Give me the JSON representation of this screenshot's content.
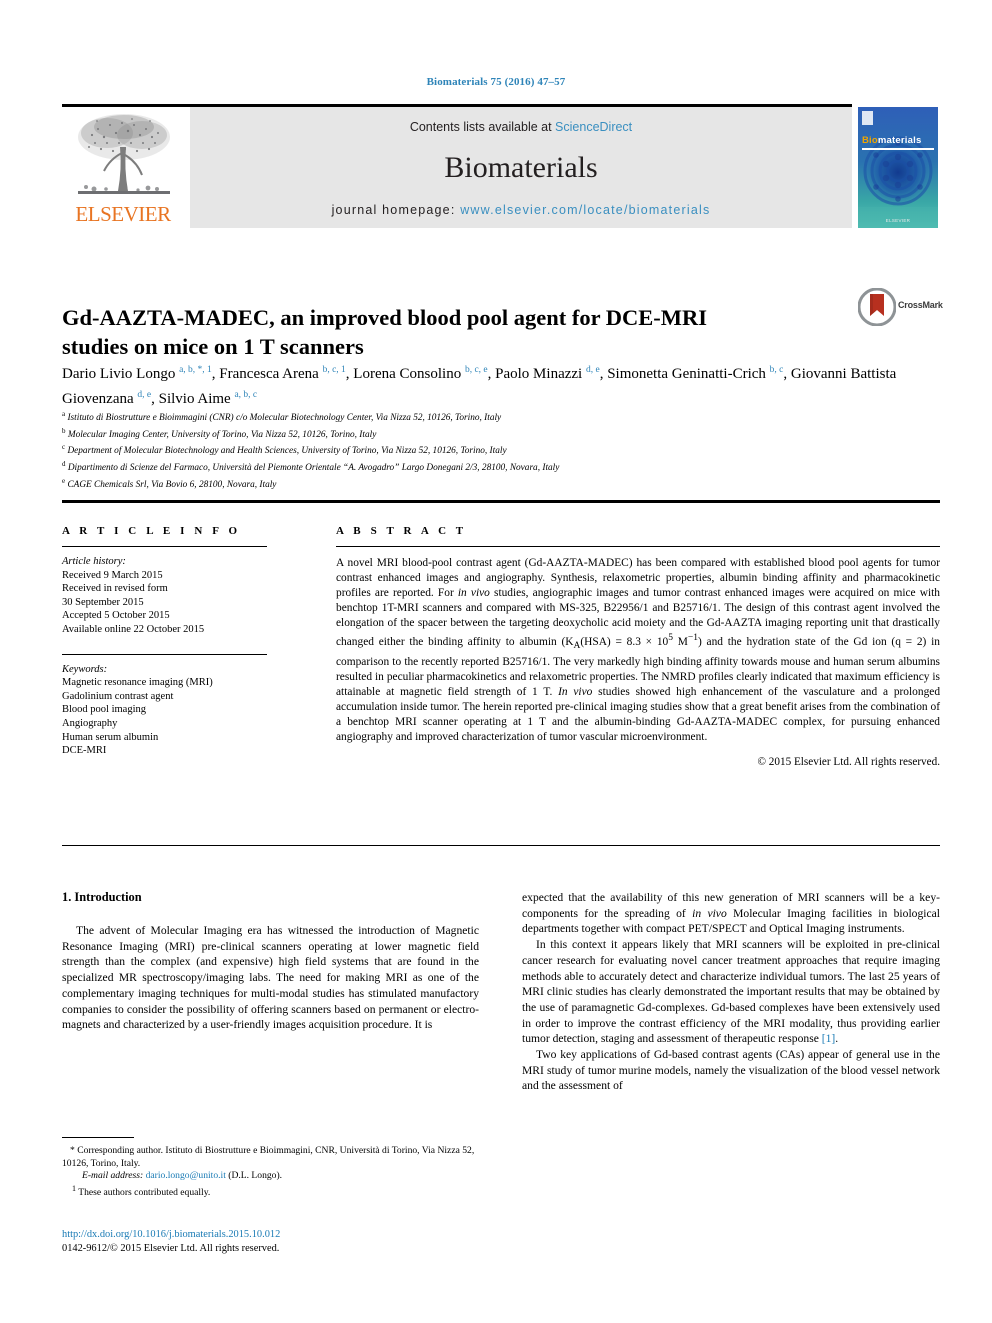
{
  "running_head": "Biomaterials 75 (2016) 47–57",
  "masthead": {
    "contents_prefix": "Contents lists available at ",
    "sciencedirect": "ScienceDirect",
    "journal_name": "Biomaterials",
    "homepage_prefix": "journal homepage: ",
    "homepage_url": "www.elsevier.com/locate/biomaterials",
    "publisher": "ELSEVIER",
    "link_color": "#3a8fc0",
    "box_color": "#e6e6e6"
  },
  "cover": {
    "title_prefix": "Bio",
    "title_rest": "materials",
    "footer": "ELSEVIER"
  },
  "article": {
    "title": "Gd-AAZTA-MADEC, an improved blood pool agent for DCE-MRI studies on mice on 1 T scanners",
    "crossmark_label": "CrossMark",
    "authors": [
      {
        "name": "Dario Livio Longo",
        "sup": "a, b, *, 1",
        "sep": ", "
      },
      {
        "name": "Francesca Arena",
        "sup": "b, c, 1",
        "sep": ", "
      },
      {
        "name": "Lorena Consolino",
        "sup": "b, c, e",
        "sep": ", "
      },
      {
        "name": "Paolo Minazzi",
        "sup": "d, e",
        "sep": ", "
      },
      {
        "name": "Simonetta Geninatti-Crich",
        "sup": "b, c",
        "sep": ", "
      },
      {
        "name": "Giovanni Battista Giovenzana",
        "sup": "d, e",
        "sep": ", "
      },
      {
        "name": "Silvio Aime",
        "sup": "a, b, c",
        "sep": ""
      }
    ],
    "affiliations": [
      {
        "mark": "a",
        "text": "Istituto di Biostrutture e Bioimmagini (CNR) c/o Molecular Biotechnology Center, Via Nizza 52, 10126, Torino, Italy"
      },
      {
        "mark": "b",
        "text": "Molecular Imaging Center, University of Torino, Via Nizza 52, 10126, Torino, Italy"
      },
      {
        "mark": "c",
        "text": "Department of Molecular Biotechnology and Health Sciences, University of Torino, Via Nizza 52, 10126, Torino, Italy"
      },
      {
        "mark": "d",
        "text": "Dipartimento di Scienze del Farmaco, Università del Piemonte Orientale “A. Avogadro” Largo Donegani 2/3, 28100, Novara, Italy"
      },
      {
        "mark": "e",
        "text": "CAGE Chemicals Srl, Via Bovio 6, 28100, Novara, Italy"
      }
    ]
  },
  "article_info": {
    "heading": "A R T I C L E   I N F O",
    "history_label": "Article history:",
    "history": [
      "Received 9 March 2015",
      "Received in revised form",
      "30 September 2015",
      "Accepted 5 October 2015",
      "Available online 22 October 2015"
    ],
    "keywords_label": "Keywords:",
    "keywords": [
      "Magnetic resonance imaging (MRI)",
      "Gadolinium contrast agent",
      "Blood pool imaging",
      "Angiography",
      "Human serum albumin",
      "DCE-MRI"
    ]
  },
  "abstract": {
    "heading": "A B S T R A C T",
    "text_part1": "A novel MRI blood-pool contrast agent (Gd-AAZTA-MADEC) has been compared with established blood pool agents for tumor contrast enhanced images and angiography. Synthesis, relaxometric properties, albumin binding affinity and pharmacokinetic profiles are reported. For ",
    "italic1": "in vivo",
    "text_part2": " studies, angiographic images and tumor contrast enhanced images were acquired on mice with benchtop 1T-MRI scanners and compared with MS-325, B22956/1 and B25716/1. The design of this contrast agent involved the elongation of the spacer between the targeting deoxycholic acid moiety and the Gd-AAZTA imaging reporting unit that drastically changed either the binding affinity to albumin (K",
    "sub_a": "A",
    "text_part3": "(HSA) = 8.3 × 10",
    "sup_5": "5",
    "text_part4": " M",
    "sup_m1": "−1",
    "text_part5": ") and the hydration state of the Gd ion (q = 2) in comparison to the recently reported B25716/1. The very markedly high binding affinity towards mouse and human serum albumins resulted in peculiar pharmacokinetics and relaxometric properties. The NMRD profiles clearly indicated that maximum efficiency is attainable at magnetic field strength of 1 T. ",
    "italic2": "In vivo",
    "text_part6": " studies showed high enhancement of the vasculature and a prolonged accumulation inside tumor. The herein reported pre-clinical imaging studies show that a great benefit arises from the combination of a benchtop MRI scanner operating at 1 T and the albumin-binding Gd-AAZTA-MADEC complex, for pursuing enhanced angiography and improved characterization of tumor vascular microenvironment.",
    "copyright": "© 2015 Elsevier Ltd. All rights reserved."
  },
  "body": {
    "section_heading": "1. Introduction",
    "left_paragraphs": [
      "The advent of Molecular Imaging era has witnessed the introduction of Magnetic Resonance Imaging (MRI) pre-clinical scanners operating at lower magnetic field strength than the complex (and expensive) high field systems that are found in the specialized MR spectroscopy/imaging labs. The need for making MRI as one of the complementary imaging techniques for multi-modal studies has stimulated manufactory companies to consider the possibility of offering scanners based on permanent or electro-magnets and characterized by a user-friendly images acquisition procedure. It is"
    ],
    "right_paragraphs": [
      "expected that the availability of this new generation of MRI scanners will be a key-components for the spreading of in vivo Molecular Imaging facilities in biological departments together with compact PET/SPECT and Optical Imaging instruments.",
      "In this context it appears likely that MRI scanners will be exploited in pre-clinical cancer research for evaluating novel cancer treatment approaches that require imaging methods able to accurately detect and characterize individual tumors. The last 25 years of MRI clinic studies has clearly demonstrated the important results that may be obtained by the use of paramagnetic Gd-complexes. Gd-based complexes have been extensively used in order to improve the contrast efficiency of the MRI modality, thus providing earlier tumor detection, staging and assessment of therapeutic response [1].",
      "Two key applications of Gd-based contrast agents (CAs) appear of general use in the MRI study of tumor murine models, namely the visualization of the blood vessel network and the assessment of"
    ],
    "right_p1_italic": "in vivo",
    "right_ref": "[1]"
  },
  "footnotes": {
    "corresponding": "* Corresponding author. Istituto di Biostrutture e Bioimmagini, CNR, Università di Torino, Via Nizza 52, 10126, Torino, Italy.",
    "email_label": "E-mail address:",
    "email": "dario.longo@unito.it",
    "email_suffix": " (D.L. Longo).",
    "equal_contrib_mark": "1",
    "equal_contrib": "These authors contributed equally."
  },
  "footer": {
    "doi": "http://dx.doi.org/10.1016/j.biomaterials.2015.10.012",
    "issn_line": "0142-9612/© 2015 Elsevier Ltd. All rights reserved."
  }
}
